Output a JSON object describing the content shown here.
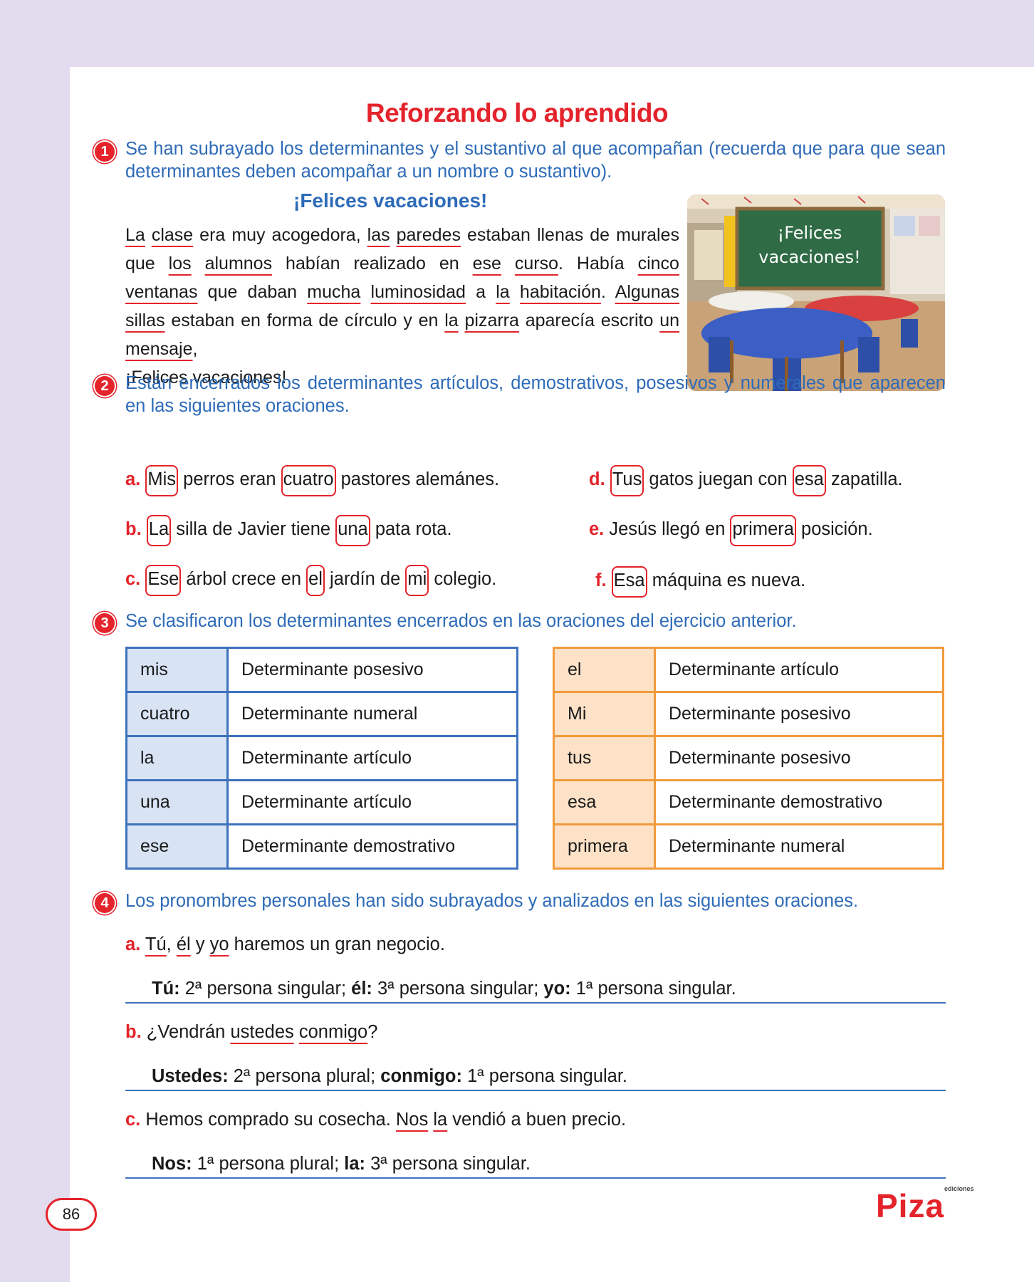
{
  "title": "Reforzando lo aprendido",
  "ex1": {
    "number": "1",
    "instruction": "Se han subrayado los determinantes y el sustantivo al que acompañan (recuerda que para que sean determinantes deben acompañar a un nombre o sustantivo).",
    "subtitle": "¡Felices vacaciones!",
    "paragraph": [
      {
        "t": "La",
        "u": true
      },
      {
        "t": " "
      },
      {
        "t": "clase",
        "u": true
      },
      {
        "t": " era muy acogedora, "
      },
      {
        "t": "las",
        "u": true
      },
      {
        "t": " "
      },
      {
        "t": "paredes",
        "u": true
      },
      {
        "t": " estaban llenas de murales que "
      },
      {
        "t": "los",
        "u": true
      },
      {
        "t": " "
      },
      {
        "t": "alumnos",
        "u": true
      },
      {
        "t": " habían realizado en "
      },
      {
        "t": "ese",
        "u": true
      },
      {
        "t": " "
      },
      {
        "t": "curso",
        "u": true
      },
      {
        "t": ". Había "
      },
      {
        "t": "cinco",
        "u": true
      },
      {
        "t": " "
      },
      {
        "t": "ventanas",
        "u": true
      },
      {
        "t": " que daban "
      },
      {
        "t": "mucha",
        "u": true
      },
      {
        "t": " "
      },
      {
        "t": "luminosidad",
        "u": true
      },
      {
        "t": " a "
      },
      {
        "t": "la",
        "u": true
      },
      {
        "t": " "
      },
      {
        "t": "habitación",
        "u": true
      },
      {
        "t": ". "
      },
      {
        "t": "Algunas",
        "u": true
      },
      {
        "t": " "
      },
      {
        "t": "sillas",
        "u": true
      },
      {
        "t": " estaban en forma de círculo y en "
      },
      {
        "t": "la",
        "u": true
      },
      {
        "t": " "
      },
      {
        "t": "pizarra",
        "u": true
      },
      {
        "t": " aparecía escrito "
      },
      {
        "t": "un",
        "u": true
      },
      {
        "t": " "
      },
      {
        "t": "mensaje",
        "u": true
      },
      {
        "t": ","
      }
    ],
    "last_line": "¡Felices vacaciones!",
    "image_text": "¡Felices vacaciones!"
  },
  "ex2": {
    "number": "2",
    "instruction": "Están encerrados los determinantes artículos, demostrativos, posesivos y numerales que aparecen en las siguientes oraciones.",
    "sentences": [
      {
        "letter": "a.",
        "parts": [
          {
            "t": "Mis",
            "b": true
          },
          {
            "t": " perros eran "
          },
          {
            "t": "cuatro",
            "b": true
          },
          {
            "t": " pastores alemánes."
          }
        ]
      },
      {
        "letter": "b.",
        "parts": [
          {
            "t": "La",
            "b": true
          },
          {
            "t": " silla de Javier tiene "
          },
          {
            "t": "una",
            "b": true
          },
          {
            "t": " pata rota."
          }
        ]
      },
      {
        "letter": "c.",
        "parts": [
          {
            "t": "Ese",
            "b": true
          },
          {
            "t": " árbol crece en "
          },
          {
            "t": "el",
            "b": true
          },
          {
            "t": " jardín de "
          },
          {
            "t": "mi",
            "b": true
          },
          {
            "t": " colegio."
          }
        ]
      },
      {
        "letter": "d.",
        "parts": [
          {
            "t": "Tus",
            "b": true
          },
          {
            "t": " gatos juegan con "
          },
          {
            "t": "esa",
            "b": true
          },
          {
            "t": " zapatilla."
          }
        ]
      },
      {
        "letter": "e.",
        "parts": [
          {
            "t": "Jesús llegó en "
          },
          {
            "t": "primera",
            "b": true
          },
          {
            "t": " posición."
          }
        ]
      },
      {
        "letter": "f.",
        "parts": [
          {
            "t": "Esa",
            "b": true
          },
          {
            "t": " máquina es nueva."
          }
        ]
      }
    ]
  },
  "ex3": {
    "number": "3",
    "instruction": "Se clasificaron los determinantes encerrados en las oraciones del ejercicio anterior.",
    "table_left": [
      [
        "mis",
        "Determinante posesivo"
      ],
      [
        "cuatro",
        "Determinante numeral"
      ],
      [
        "la",
        "Determinante artículo"
      ],
      [
        "una",
        "Determinante artículo"
      ],
      [
        "ese",
        "Determinante demostrativo"
      ]
    ],
    "table_right": [
      [
        "el",
        "Determinante artículo"
      ],
      [
        "Mi",
        "Determinante posesivo"
      ],
      [
        "tus",
        "Determinante posesivo"
      ],
      [
        "esa",
        "Determinante demostrativo"
      ],
      [
        "primera",
        "Determinante numeral"
      ]
    ]
  },
  "ex4": {
    "number": "4",
    "instruction": "Los pronombres personales han sido subrayados y analizados en las siguientes oraciones.",
    "items": [
      {
        "letter": "a.",
        "parts": [
          {
            "t": "Tú",
            "u": true
          },
          {
            "t": ", "
          },
          {
            "t": "él",
            "u": true
          },
          {
            "t": " y "
          },
          {
            "t": "yo",
            "u": true
          },
          {
            "t": " haremos un gran negocio."
          }
        ],
        "answer": [
          {
            "t": "Tú:",
            "b": true
          },
          {
            "t": " 2ª persona singular; "
          },
          {
            "t": "él:",
            "b": true
          },
          {
            "t": " 3ª persona singular; "
          },
          {
            "t": "yo:",
            "b": true
          },
          {
            "t": " 1ª persona singular."
          }
        ]
      },
      {
        "letter": "b.",
        "parts": [
          {
            "t": "¿Vendrán "
          },
          {
            "t": "ustedes",
            "u": true
          },
          {
            "t": " "
          },
          {
            "t": "conmigo",
            "u": true
          },
          {
            "t": "?"
          }
        ],
        "answer": [
          {
            "t": "Ustedes:",
            "b": true
          },
          {
            "t": " 2ª persona plural; "
          },
          {
            "t": "conmigo:",
            "b": true
          },
          {
            "t": " 1ª persona singular."
          }
        ]
      },
      {
        "letter": "c.",
        "parts": [
          {
            "t": "Hemos comprado su cosecha. "
          },
          {
            "t": "Nos",
            "u": true
          },
          {
            "t": " "
          },
          {
            "t": "la",
            "u": true
          },
          {
            "t": " vendió a buen precio."
          }
        ],
        "answer": [
          {
            "t": "Nos:",
            "b": true
          },
          {
            "t": " 1ª persona plural; "
          },
          {
            "t": "la:",
            "b": true
          },
          {
            "t": " 3ª persona singular."
          }
        ]
      }
    ]
  },
  "footer": {
    "page_number": "86",
    "logo": "Piza",
    "logo_small": "ediciones"
  },
  "colors": {
    "accent": "#e4232b",
    "blue": "#2e6bb8",
    "orange": "#f19a3c",
    "lavender": "#e3dcef"
  }
}
